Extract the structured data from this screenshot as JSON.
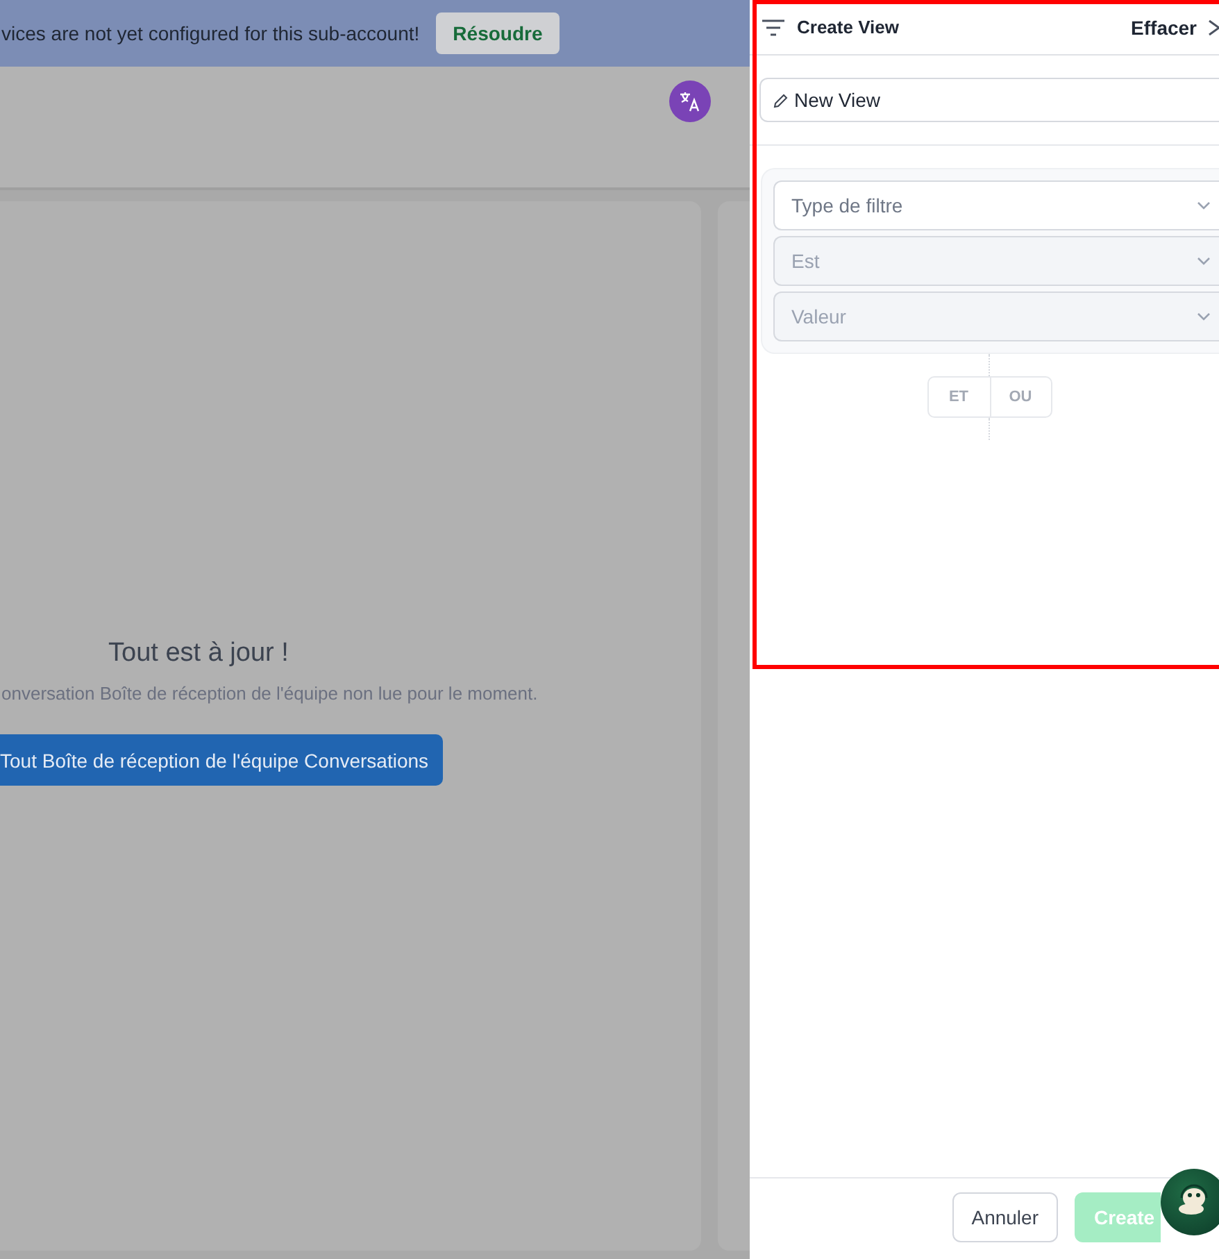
{
  "banner": {
    "message": "vices are not yet configured for this sub-account!",
    "action": "Résoudre"
  },
  "empty_state": {
    "title": "Tout est à jour !",
    "message": "onversation Boîte de réception de l'équipe non lue pour le moment.",
    "button": "Tout Boîte de réception de l'équipe Conversations"
  },
  "panel": {
    "title": "Create View",
    "clear": "Effacer",
    "name_value": "New View",
    "filters": [
      {
        "placeholder": "Type de filtre",
        "disabled": false
      },
      {
        "placeholder": "Est",
        "disabled": true
      },
      {
        "placeholder": "Valeur",
        "disabled": true
      }
    ],
    "logic": [
      {
        "label": "ET",
        "disabled": true
      },
      {
        "label": "OU",
        "disabled": true
      }
    ],
    "cancel": "Annuler",
    "create": {
      "label": "Create",
      "disabled": true
    }
  }
}
